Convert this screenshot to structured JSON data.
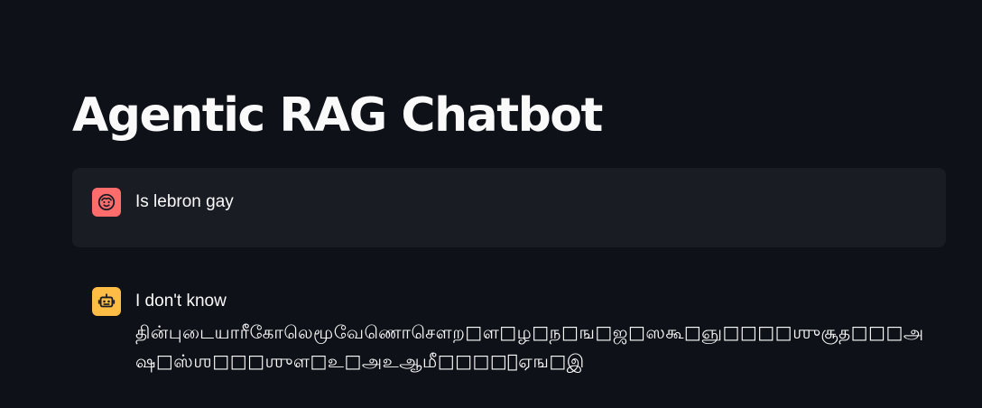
{
  "app": {
    "title": "Agentic RAG Chatbot"
  },
  "colors": {
    "background": "#0e1117",
    "user_bubble": "#1a1c24",
    "user_avatar": "#ff6c6c",
    "assistant_avatar": "#ffbd45",
    "text": "#fafafa"
  },
  "messages": [
    {
      "role": "user",
      "avatar_icon": "smiley-face-icon",
      "text": "Is lebron gay"
    },
    {
      "role": "assistant",
      "avatar_icon": "robot-icon",
      "text": "I don't know",
      "garbled_text": "தின்புடையாரீகோலெமூவேணொசெளற□ள□ழ□ந□ங□ஜ□ஸகூ□ஞு□□□□ஶுசூத□□□அஷ□ஸ்ஶ□□□ஶுள□உ□அஉஆமீ□□□□ாஏங□இ"
    }
  ]
}
